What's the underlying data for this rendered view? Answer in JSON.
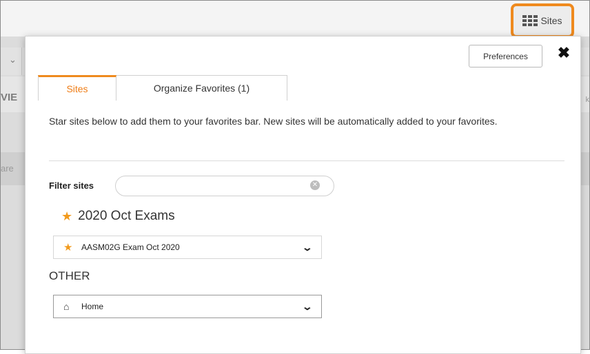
{
  "header": {
    "sites_button_label": "Sites",
    "sites_button_highlight": "#ef8a1e"
  },
  "background": {
    "left_fragment_1": "VIE",
    "left_fragment_2": "are",
    "right_fragment": "k"
  },
  "modal": {
    "preferences_label": "Preferences",
    "close_icon": "close-icon",
    "tabs": [
      {
        "label": "Sites",
        "active": true
      },
      {
        "label": "Organize Favorites (1)",
        "active": false
      }
    ],
    "intro_text": "Star sites below to add them to your favorites bar. New sites will be automatically added to your favorites.",
    "filter": {
      "label": "Filter sites",
      "value": "",
      "placeholder": ""
    },
    "favorite_group": {
      "title": "2020 Oct Exams",
      "sites": [
        {
          "label": "AASM02G Exam Oct 2020",
          "icon": "star-icon"
        }
      ]
    },
    "other_group": {
      "title": "OTHER",
      "sites": [
        {
          "label": "Home",
          "icon": "home-icon"
        }
      ]
    }
  },
  "colors": {
    "accent": "#ef8a1e",
    "star": "#f29a1c",
    "active_tab_text": "#ef7d16"
  }
}
